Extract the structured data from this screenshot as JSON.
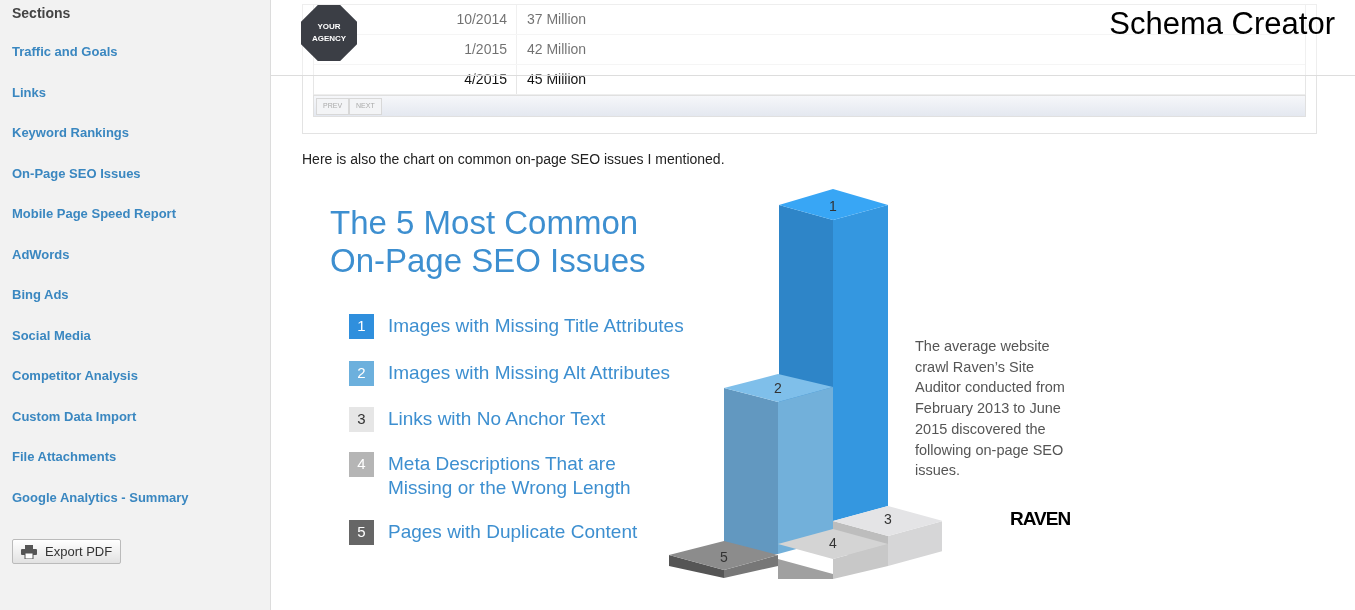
{
  "sidebar": {
    "title": "Sections",
    "items": [
      "Traffic and Goals",
      "Links",
      "Keyword Rankings",
      "On-Page SEO Issues",
      "Mobile Page Speed Report",
      "AdWords",
      "Bing Ads",
      "Social Media",
      "Competitor Analysis",
      "Custom Data Import",
      "File Attachments",
      "Google Analytics - Summary"
    ],
    "export_button": "Export PDF"
  },
  "header": {
    "logo_text": "YOUR AGENCY",
    "title": "Schema Creator"
  },
  "table": {
    "rows": [
      {
        "date": "10/2014",
        "value": "37 Million"
      },
      {
        "date": "1/2015",
        "value": "42 Million"
      },
      {
        "date": "4/2015",
        "value": "45 Million"
      }
    ],
    "pager": [
      "PREV",
      "NEXT"
    ]
  },
  "intro": "Here is also the chart on common on-page SEO issues I mentioned.",
  "infographic": {
    "title_lines": [
      "The 5 Most Common",
      "On-Page SEO Issues"
    ],
    "issues": [
      {
        "number": "1",
        "lines": [
          "Images with Missing Title Attributes"
        ],
        "color": "#2f8fdd"
      },
      {
        "number": "2",
        "lines": [
          "Images with Missing Alt Attributes"
        ],
        "color": "#6cb0dd"
      },
      {
        "number": "3",
        "lines": [
          "Links with No Anchor Text"
        ],
        "color": "#e6e6e6"
      },
      {
        "number": "4",
        "lines": [
          "Meta Descriptions That are",
          "Missing or the Wrong Length"
        ],
        "color": "#b5b5b5"
      },
      {
        "number": "5",
        "lines": [
          "Pages with Duplicate Content"
        ],
        "color": "#666666"
      }
    ],
    "bar_labels": [
      "1",
      "2",
      "3",
      "4",
      "5"
    ],
    "blurb": "The average website crawl Raven’s Site Auditor conducted from February 2013 to June 2015 discovered the following on-page SEO issues.",
    "logo_text": "RAVEN"
  }
}
